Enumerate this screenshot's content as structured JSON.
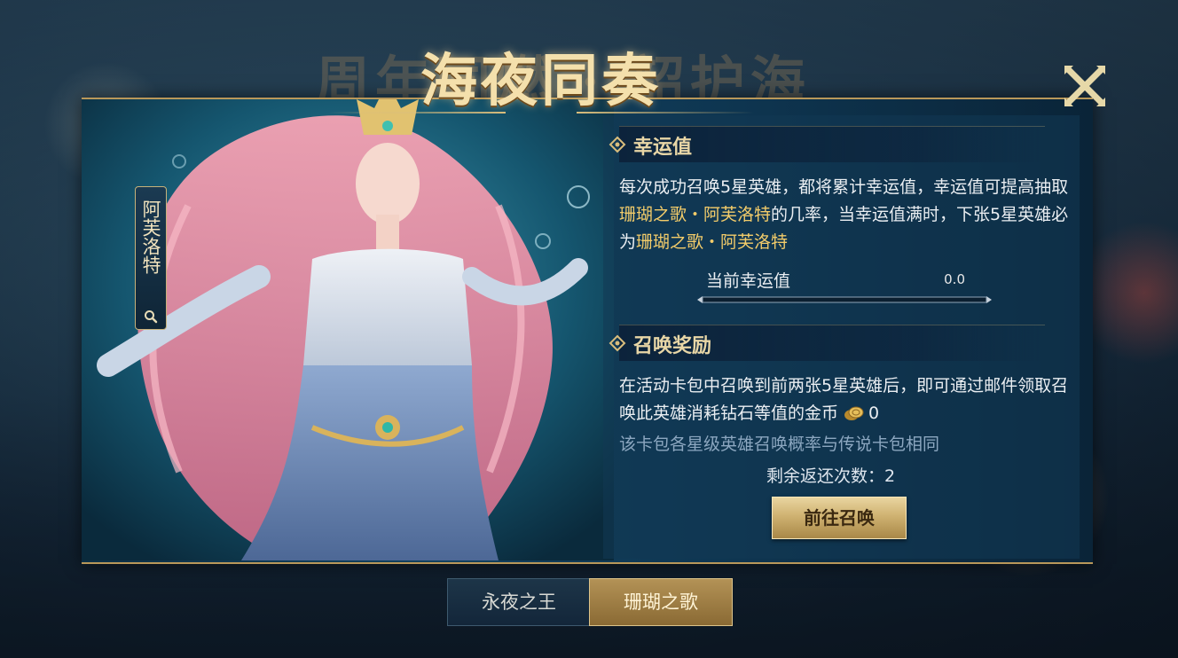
{
  "event": {
    "title": "海夜同奏",
    "background_title": "周年同燃 · 韶护海"
  },
  "hero": {
    "name": "阿芙洛特"
  },
  "luck_section": {
    "heading": "幸运值",
    "desc_part1": "每次成功召唤5星英雄，都将累计幸运值，幸运值可提高抽取",
    "desc_hero1": "珊瑚之歌・阿芙洛特",
    "desc_part2": "的几率，当幸运值满时，下张5星英雄必为",
    "desc_hero2": "珊瑚之歌・阿芙洛特",
    "current_label": "当前幸运值",
    "current_value": "0.0",
    "progress_fraction": 0.0
  },
  "reward_section": {
    "heading": "召唤奖励",
    "desc": "在活动卡包中召唤到前两张5星英雄后，即可通过邮件领取召唤此英雄消耗钻石等值的金币",
    "coin_amount": "0",
    "note": "该卡包各星级英雄召唤概率与传说卡包相同",
    "remaining": "剩余返还次数：2",
    "go_button": "前往召唤"
  },
  "tabs": [
    {
      "label": "永夜之王",
      "active": false
    },
    {
      "label": "珊瑚之歌",
      "active": true
    }
  ],
  "colors": {
    "accent_gold": "#d9bd7c",
    "highlight": "#f3cc6a",
    "panel_blue": "#124260"
  }
}
